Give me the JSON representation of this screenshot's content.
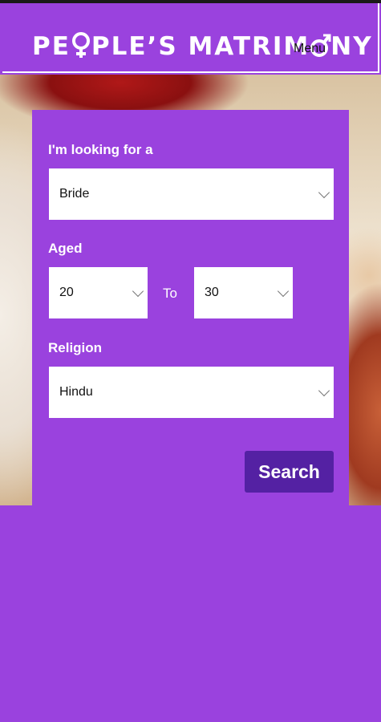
{
  "header": {
    "logo_part1": "PE",
    "logo_part2": "PLE’S MATRIM",
    "logo_part3": "NY",
    "menu_label": "Menu"
  },
  "form": {
    "looking_for_label": "I'm looking for a",
    "looking_for_value": "Bride",
    "aged_label": "Aged",
    "age_from_value": "20",
    "to_label": "To",
    "age_to_value": "30",
    "religion_label": "Religion",
    "religion_value": "Hindu",
    "search_label": "Search"
  },
  "colors": {
    "brand_purple": "#9a42de",
    "button_purple": "#5421a3"
  }
}
